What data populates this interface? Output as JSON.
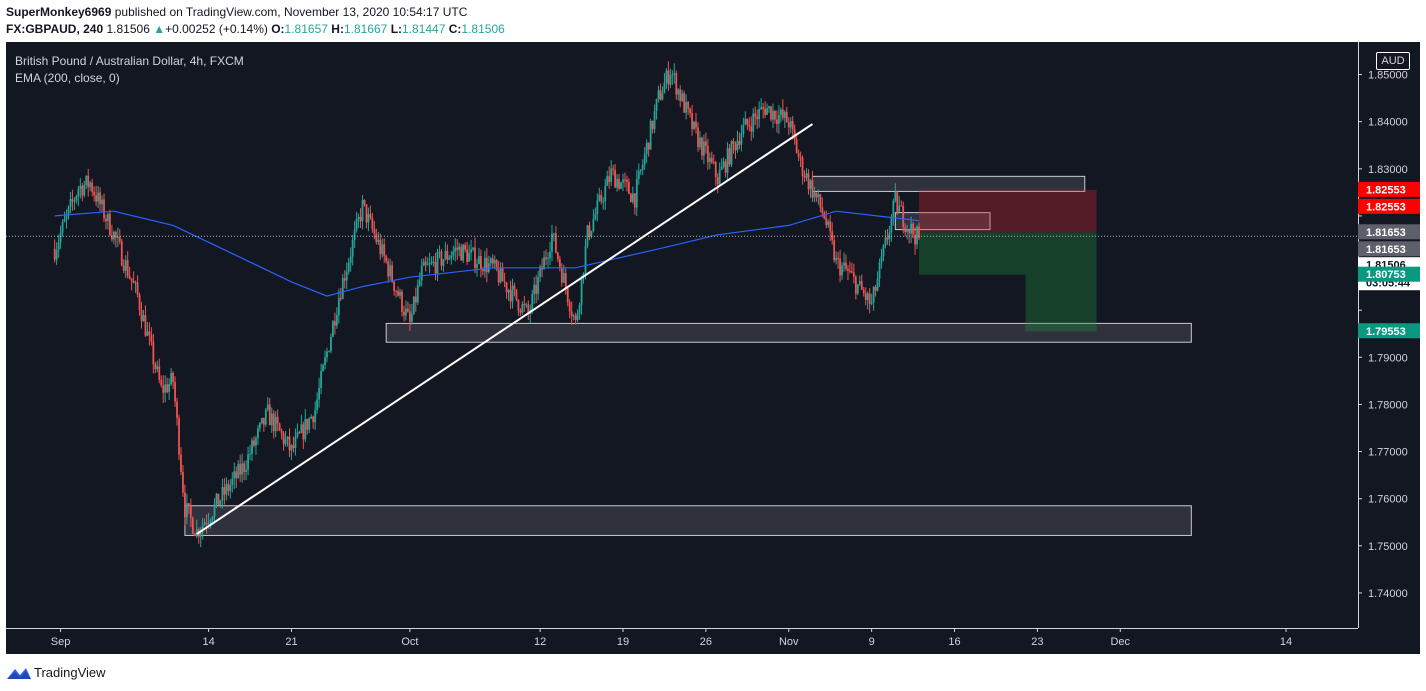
{
  "header": {
    "author": "SuperMonkey6969",
    "published": "published on TradingView.com, November 13, 2020 10:54:17 UTC",
    "symbol": "FX:GBPAUD, 240",
    "last": "1.81506",
    "change": "+0.00252 (+0.14%)",
    "o_label": "O:",
    "o_value": "1.81657",
    "h_label": "H:",
    "h_value": "1.81667",
    "l_label": "L:",
    "l_value": "1.81447",
    "c_label": "C:",
    "c_value": "1.81506"
  },
  "legend": {
    "title": "British Pound / Australian Dollar, 4h, FXCM",
    "indicator": "EMA (200, close, 0)"
  },
  "currency": "AUD",
  "footer": {
    "brand": "TradingView"
  },
  "colors": {
    "background": "#131722",
    "up": "#26a69a",
    "down": "#ef5350",
    "ema": "#2962ff",
    "stop": "#ff0000",
    "target": "#089981",
    "zone": "#5d606b"
  },
  "chart_data": {
    "type": "candlestick",
    "title": "British Pound / Australian Dollar, 4h, FXCM",
    "ylim": [
      1.735,
      1.855
    ],
    "yticks": [
      1.74,
      1.75,
      1.76,
      1.77,
      1.78,
      1.79,
      1.8,
      1.81,
      1.82,
      1.83,
      1.84,
      1.85
    ],
    "ytick_labels": [
      "1.74000",
      "1.75000",
      "1.76000",
      "1.77000",
      "1.78000",
      "1.79000",
      "",
      "",
      "",
      "1.83000",
      "1.84000",
      "1.85000"
    ],
    "x_ticks": [
      "Sep",
      "14",
      "21",
      "Oct",
      "12",
      "19",
      "26",
      "Nov",
      "9",
      "16",
      "23",
      "Dec",
      "14"
    ],
    "anchors": [
      [
        "2020-09-01",
        1.813
      ],
      [
        "2020-09-03",
        1.826
      ],
      [
        "2020-09-04",
        1.827
      ],
      [
        "2020-09-06",
        1.816
      ],
      [
        "2020-09-08",
        1.803
      ],
      [
        "2020-09-10",
        1.783
      ],
      [
        "2020-09-11",
        1.785
      ],
      [
        "2020-09-12",
        1.758
      ],
      [
        "2020-09-13",
        1.753
      ],
      [
        "2020-09-15",
        1.76
      ],
      [
        "2020-09-17",
        1.767
      ],
      [
        "2020-09-19",
        1.778
      ],
      [
        "2020-09-21",
        1.77
      ],
      [
        "2020-09-23",
        1.779
      ],
      [
        "2020-09-25",
        1.803
      ],
      [
        "2020-09-27",
        1.822
      ],
      [
        "2020-09-29",
        1.81
      ],
      [
        "2020-10-01",
        1.797
      ],
      [
        "2020-10-02",
        1.808
      ],
      [
        "2020-10-05",
        1.813
      ],
      [
        "2020-10-08",
        1.809
      ],
      [
        "2020-10-11",
        1.799
      ],
      [
        "2020-10-13",
        1.816
      ],
      [
        "2020-10-15",
        1.797
      ],
      [
        "2020-10-16",
        1.816
      ],
      [
        "2020-10-18",
        1.829
      ],
      [
        "2020-10-20",
        1.824
      ],
      [
        "2020-10-22",
        1.845
      ],
      [
        "2020-10-23",
        1.851
      ],
      [
        "2020-10-25",
        1.838
      ],
      [
        "2020-10-27",
        1.828
      ],
      [
        "2020-10-29",
        1.838
      ],
      [
        "2020-10-31",
        1.843
      ],
      [
        "2020-11-02",
        1.84
      ],
      [
        "2020-11-03",
        1.831
      ],
      [
        "2020-11-05",
        1.82
      ],
      [
        "2020-11-06",
        1.81
      ],
      [
        "2020-11-07",
        1.808
      ],
      [
        "2020-11-09",
        1.801
      ],
      [
        "2020-11-10",
        1.812
      ],
      [
        "2020-11-11",
        1.823
      ],
      [
        "2020-11-12",
        1.818
      ],
      [
        "2020-11-13",
        1.815
      ]
    ],
    "ema": [
      [
        "2020-09-01",
        1.82
      ],
      [
        "2020-09-06",
        1.821
      ],
      [
        "2020-09-11",
        1.818
      ],
      [
        "2020-09-16",
        1.812
      ],
      [
        "2020-09-21",
        1.806
      ],
      [
        "2020-09-24",
        1.803
      ],
      [
        "2020-09-27",
        1.805
      ],
      [
        "2020-10-01",
        1.807
      ],
      [
        "2020-10-08",
        1.809
      ],
      [
        "2020-10-15",
        1.809
      ],
      [
        "2020-10-22",
        1.813
      ],
      [
        "2020-10-27",
        1.816
      ],
      [
        "2020-11-02",
        1.818
      ],
      [
        "2020-11-06",
        1.821
      ],
      [
        "2020-11-13",
        1.819
      ]
    ],
    "trendline": [
      [
        "2020-09-13",
        1.7525
      ],
      [
        "2020-11-04",
        1.8395
      ]
    ],
    "zones": [
      {
        "from": "2020-09-12",
        "to": "2020-12-06",
        "low": 1.7522,
        "high": 1.7585
      },
      {
        "from": "2020-09-29",
        "to": "2020-12-06",
        "low": 1.7932,
        "high": 1.7972
      },
      {
        "from": "2020-11-04",
        "to": "2020-11-27",
        "low": 1.8252,
        "high": 1.8284
      },
      {
        "from": "2020-11-11",
        "to": "2020-11-19",
        "low": 1.8171,
        "high": 1.8207
      }
    ],
    "position": {
      "from": "2020-11-13",
      "to": "2020-11-28",
      "entry": 1.81653,
      "stop": 1.82553,
      "target1": 1.80753,
      "target2": 1.79553,
      "partial_until": "2020-11-22"
    },
    "price_labels": [
      {
        "value": 1.82553,
        "text": "1.82553",
        "bg": "#ff0000",
        "fg": "#ffffff"
      },
      {
        "value": 1.82553,
        "text": "1.82553",
        "bg": "#ff0000",
        "fg": "#ffffff",
        "offset": 1
      },
      {
        "value": 1.81653,
        "text": "1.81653",
        "bg": "#5d606b",
        "fg": "#ffffff"
      },
      {
        "value": 1.81653,
        "text": "1.81653",
        "bg": "#5d606b",
        "fg": "#ffffff",
        "offset": 1
      },
      {
        "value": 1.81506,
        "text": "1.81506",
        "bg": "#ffffff",
        "fg": "#131722"
      },
      {
        "value": 1.81506,
        "text": "03:05:44",
        "bg": "#ffffff",
        "fg": "#131722",
        "offset": 1
      },
      {
        "value": 1.80753,
        "text": "1.80753",
        "bg": "#089981",
        "fg": "#ffffff"
      },
      {
        "value": 1.79553,
        "text": "1.79553",
        "bg": "#089981",
        "fg": "#ffffff"
      }
    ],
    "last_price": 1.81506
  }
}
